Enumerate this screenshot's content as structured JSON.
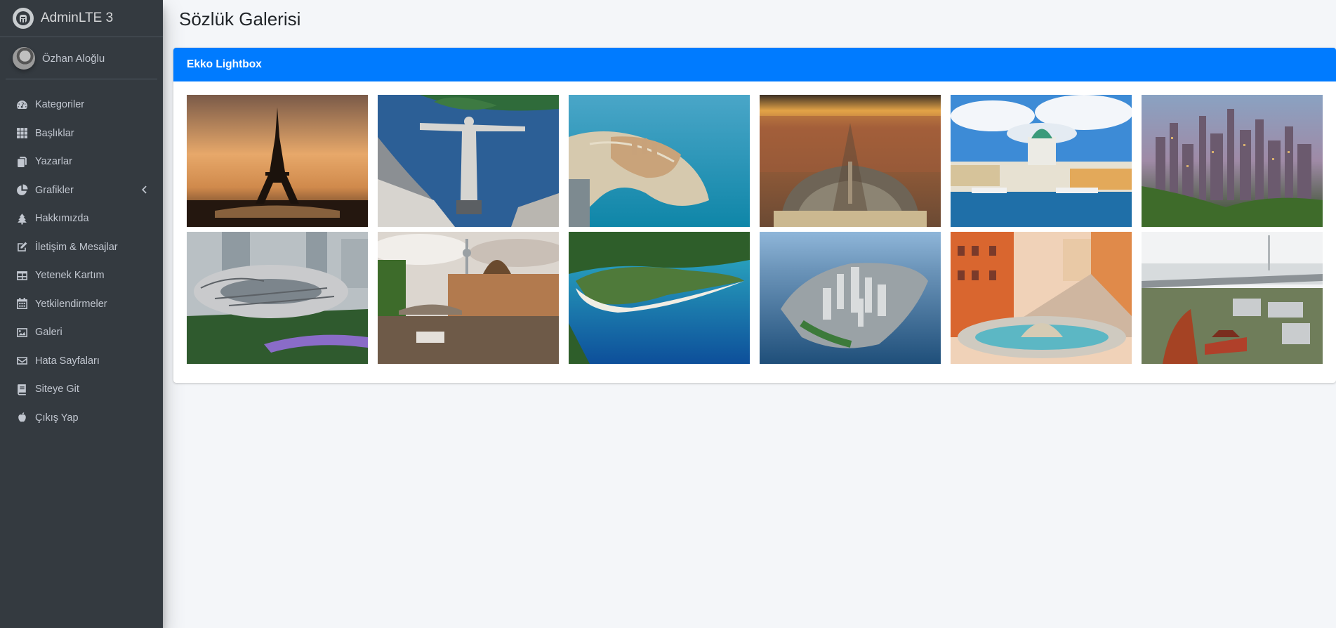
{
  "brand": {
    "title": "AdminLTE 3"
  },
  "user": {
    "name": "Özhan Aloğlu"
  },
  "sidebar": {
    "items": [
      {
        "label": "Kategoriler",
        "icon": "tachometer-icon"
      },
      {
        "label": "Başlıklar",
        "icon": "grid-icon"
      },
      {
        "label": "Yazarlar",
        "icon": "copy-icon"
      },
      {
        "label": "Grafikler",
        "icon": "pie-chart-icon",
        "has_caret": true
      },
      {
        "label": "Hakkımızda",
        "icon": "tree-icon"
      },
      {
        "label": "İletişim & Mesajlar",
        "icon": "edit-icon"
      },
      {
        "label": "Yetenek Kartım",
        "icon": "table-icon"
      },
      {
        "label": "Yetkilendirmeler",
        "icon": "calendar-icon"
      },
      {
        "label": "Galeri",
        "icon": "image-icon"
      },
      {
        "label": "Hata Sayfaları",
        "icon": "envelope-icon"
      },
      {
        "label": "Siteye Git",
        "icon": "book-icon"
      },
      {
        "label": "Çıkış Yap",
        "icon": "apple-icon"
      }
    ]
  },
  "page": {
    "title": "Sözlük Galerisi"
  },
  "card": {
    "title": "Ekko Lightbox"
  },
  "colors": {
    "sidebar_bg": "#343a40",
    "accent": "#007bff",
    "content_bg": "#f4f6f9"
  },
  "gallery": {
    "images": [
      {
        "subject": "eiffel-tower-sunset"
      },
      {
        "subject": "christ-the-redeemer-rio"
      },
      {
        "subject": "pearl-island-doha"
      },
      {
        "subject": "st-peters-square-vatican"
      },
      {
        "subject": "helsinki-cathedral-harbor"
      },
      {
        "subject": "hong-kong-skyline"
      },
      {
        "subject": "museum-of-the-future-dubai"
      },
      {
        "subject": "berlin-bode-museum-spree"
      },
      {
        "subject": "oludeniz-beach"
      },
      {
        "subject": "manhattan-aerial"
      },
      {
        "subject": "rome-spanish-steps-fountain"
      },
      {
        "subject": "wuhan-yellow-crane-view"
      }
    ]
  }
}
